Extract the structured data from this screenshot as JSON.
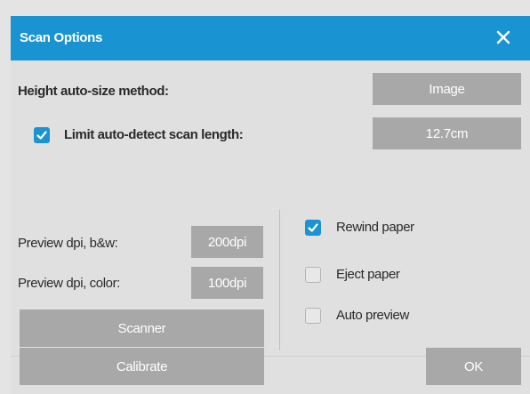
{
  "dialog": {
    "title": "Scan Options",
    "accent_color": "#1a93d2",
    "close_icon": "close-icon"
  },
  "height_autosize": {
    "label": "Height auto-size method:",
    "value": "Image"
  },
  "limit_scan_length": {
    "label": "Limit auto-detect scan length:",
    "checked": true,
    "value": "12.7cm"
  },
  "preview": {
    "bw_label": "Preview dpi, b&w:",
    "bw_value": "200dpi",
    "color_label": "Preview dpi, color:",
    "color_value": "100dpi"
  },
  "scanner_button": "Scanner",
  "options": [
    {
      "label": "Rewind paper",
      "checked": true
    },
    {
      "label": "Eject paper",
      "checked": false
    },
    {
      "label": "Auto preview",
      "checked": false
    }
  ],
  "footer": {
    "calibrate_label": "Calibrate",
    "ok_label": "OK"
  }
}
